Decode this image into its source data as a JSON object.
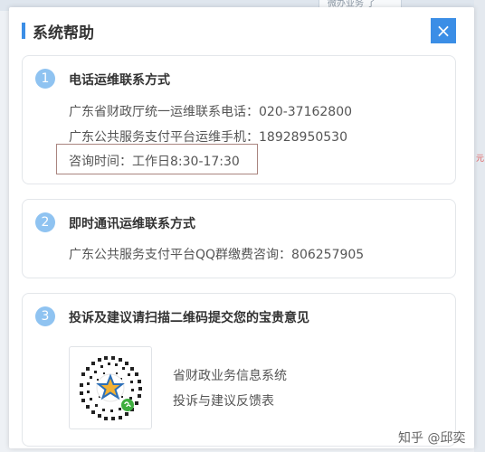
{
  "background": {
    "tab_label": "微办业务 了",
    "right_mark": "元"
  },
  "modal": {
    "title": "系统帮助",
    "close_icon": "×"
  },
  "cards": [
    {
      "number": "1",
      "title": "电话运维联系方式",
      "lines": [
        "广东省财政厅统一运维联系电话：020-37162800",
        "广东公共服务支付平台运维手机：18928950530",
        "咨询时间：工作日8:30-17:30"
      ]
    },
    {
      "number": "2",
      "title": "即时通讯运维联系方式",
      "lines": [
        "广东公共服务支付平台QQ群缴费咨询：806257905"
      ]
    },
    {
      "number": "3",
      "title": "投诉及建议请扫描二维码提交您的宝贵意见",
      "qr_caption_line1": "省财政业务信息系统",
      "qr_caption_line2": "投诉与建议反馈表"
    }
  ],
  "watermark": "知乎 @邱奕",
  "colors": {
    "accent": "#3b8ee6",
    "number_badge": "#8fc3f1",
    "highlight_border": "#a9847f"
  }
}
